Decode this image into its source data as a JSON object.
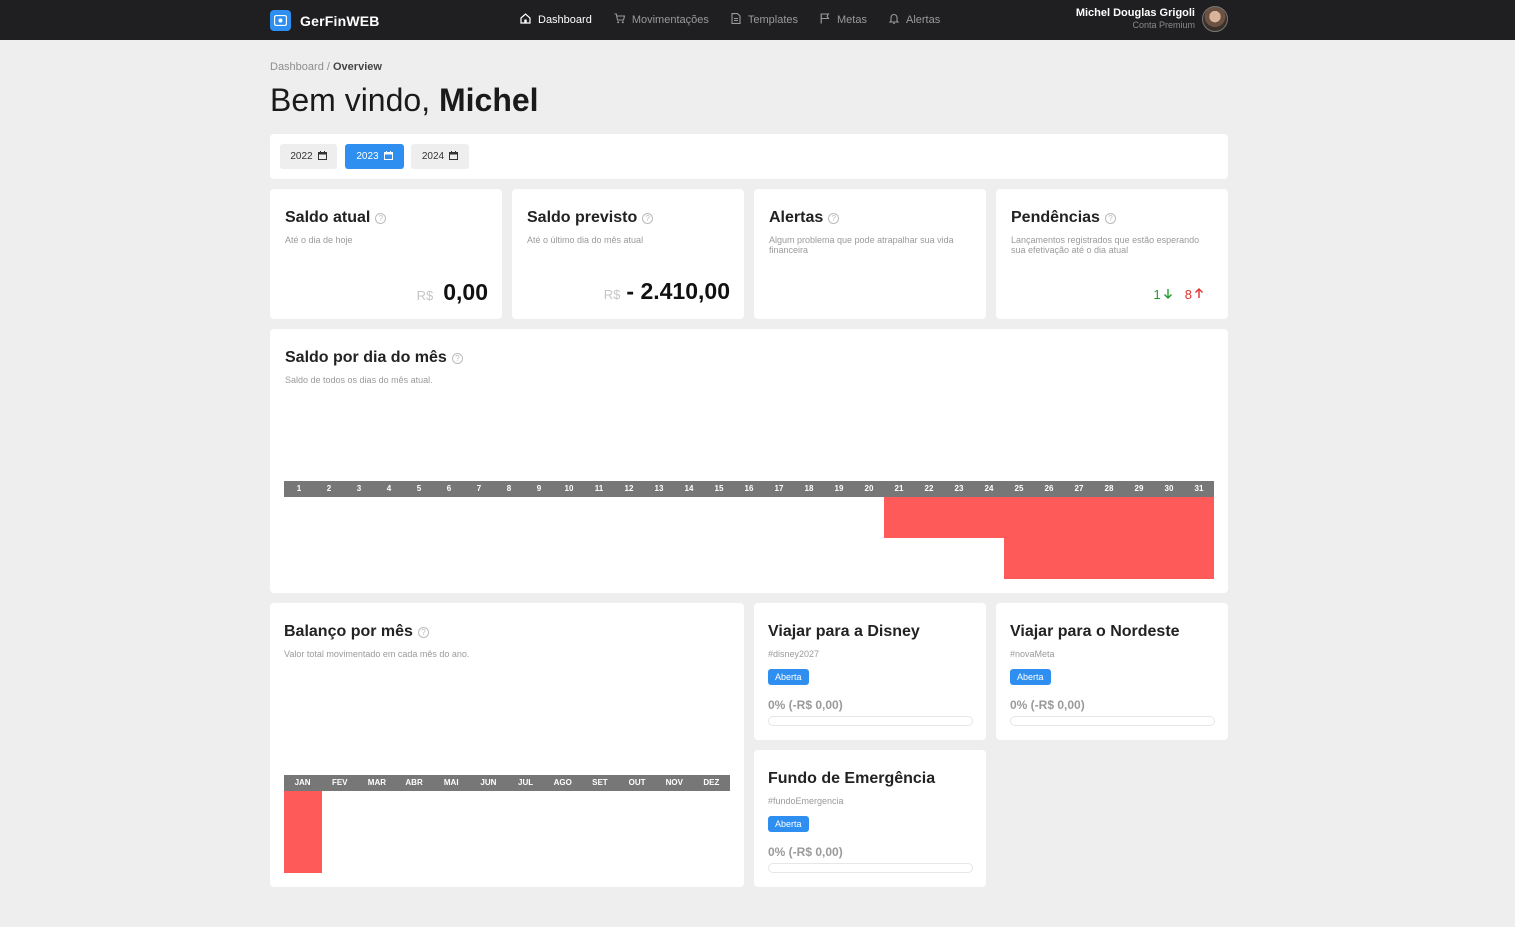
{
  "app": {
    "name": "GerFinWEB"
  },
  "nav": {
    "items": [
      {
        "label": "Dashboard",
        "icon": "home-icon",
        "active": true
      },
      {
        "label": "Movimentações",
        "icon": "cart-icon",
        "active": false
      },
      {
        "label": "Templates",
        "icon": "document-icon",
        "active": false
      },
      {
        "label": "Metas",
        "icon": "flag-icon",
        "active": false
      },
      {
        "label": "Alertas",
        "icon": "bell-icon",
        "active": false
      }
    ]
  },
  "user": {
    "name": "Michel Douglas Grigoli",
    "plan": "Conta Premium"
  },
  "breadcrumb": {
    "root": "Dashboard",
    "separator": " / ",
    "current": "Overview"
  },
  "title": {
    "prefix": "Bem vindo, ",
    "name": "Michel"
  },
  "years": [
    {
      "label": "2022",
      "active": false
    },
    {
      "label": "2023",
      "active": true
    },
    {
      "label": "2024",
      "active": false
    }
  ],
  "cards": {
    "saldo_atual": {
      "title": "Saldo atual",
      "subtitle": "Até o dia de hoje",
      "currency": "R$",
      "value": "0,00"
    },
    "saldo_previsto": {
      "title": "Saldo previsto",
      "subtitle": "Até o último dia do mês atual",
      "currency": "R$",
      "value": "- 2.410,00"
    },
    "alertas": {
      "title": "Alertas",
      "subtitle": "Algum problema que pode atrapalhar sua vida financeira"
    },
    "pendencias": {
      "title": "Pendências",
      "subtitle": "Lançamentos registrados que estão esperando sua efetivação até o dia atual",
      "down_count": "1",
      "up_count": "8"
    }
  },
  "daily_chart": {
    "title": "Saldo por dia do mês",
    "subtitle": "Saldo de todos os dias do mês atual."
  },
  "monthly_chart": {
    "title": "Balanço por mês",
    "subtitle": "Valor total movimentado em cada mês do ano."
  },
  "goals": [
    {
      "title": "Viajar para a Disney",
      "tag": "#disney2027",
      "status": "Aberta",
      "progress_text": "0% (-R$ 0,00)",
      "progress": 0
    },
    {
      "title": "Viajar para o Nordeste",
      "tag": "#novaMeta",
      "status": "Aberta",
      "progress_text": "0% (-R$ 0,00)",
      "progress": 0
    },
    {
      "title": "Fundo de Emergência",
      "tag": "#fundoEmergencia",
      "status": "Aberta",
      "progress_text": "0% (-R$ 0,00)",
      "progress": 0
    }
  ],
  "colors": {
    "navbar": "#1f1f21",
    "accent": "#2f8ff0",
    "negative": "#ff5a5a",
    "axis": "#777777",
    "positive": "#1e9a2c",
    "alert": "#e03131"
  },
  "chart_data": [
    {
      "type": "bar",
      "title": "Saldo por dia do mês",
      "categories": [
        "1",
        "2",
        "3",
        "4",
        "5",
        "6",
        "7",
        "8",
        "9",
        "10",
        "11",
        "12",
        "13",
        "14",
        "15",
        "16",
        "17",
        "18",
        "19",
        "20",
        "21",
        "22",
        "23",
        "24",
        "25",
        "26",
        "27",
        "28",
        "29",
        "30",
        "31"
      ],
      "values": [
        0,
        0,
        0,
        0,
        0,
        0,
        0,
        0,
        0,
        0,
        0,
        0,
        0,
        0,
        0,
        0,
        0,
        0,
        0,
        0,
        -1,
        -1,
        -1,
        -1,
        -2,
        -2,
        -2,
        -2,
        -2,
        -2,
        -2
      ],
      "ylim": [
        -2,
        0
      ],
      "grid": false
    },
    {
      "type": "bar",
      "title": "Balanço por mês",
      "categories": [
        "JAN",
        "FEV",
        "MAR",
        "ABR",
        "MAI",
        "JUN",
        "JUL",
        "AGO",
        "SET",
        "OUT",
        "NOV",
        "DEZ"
      ],
      "values": [
        -1,
        0,
        0,
        0,
        0,
        0,
        0,
        0,
        0,
        0,
        0,
        0
      ],
      "ylim": [
        -1,
        0
      ],
      "grid": false
    }
  ]
}
